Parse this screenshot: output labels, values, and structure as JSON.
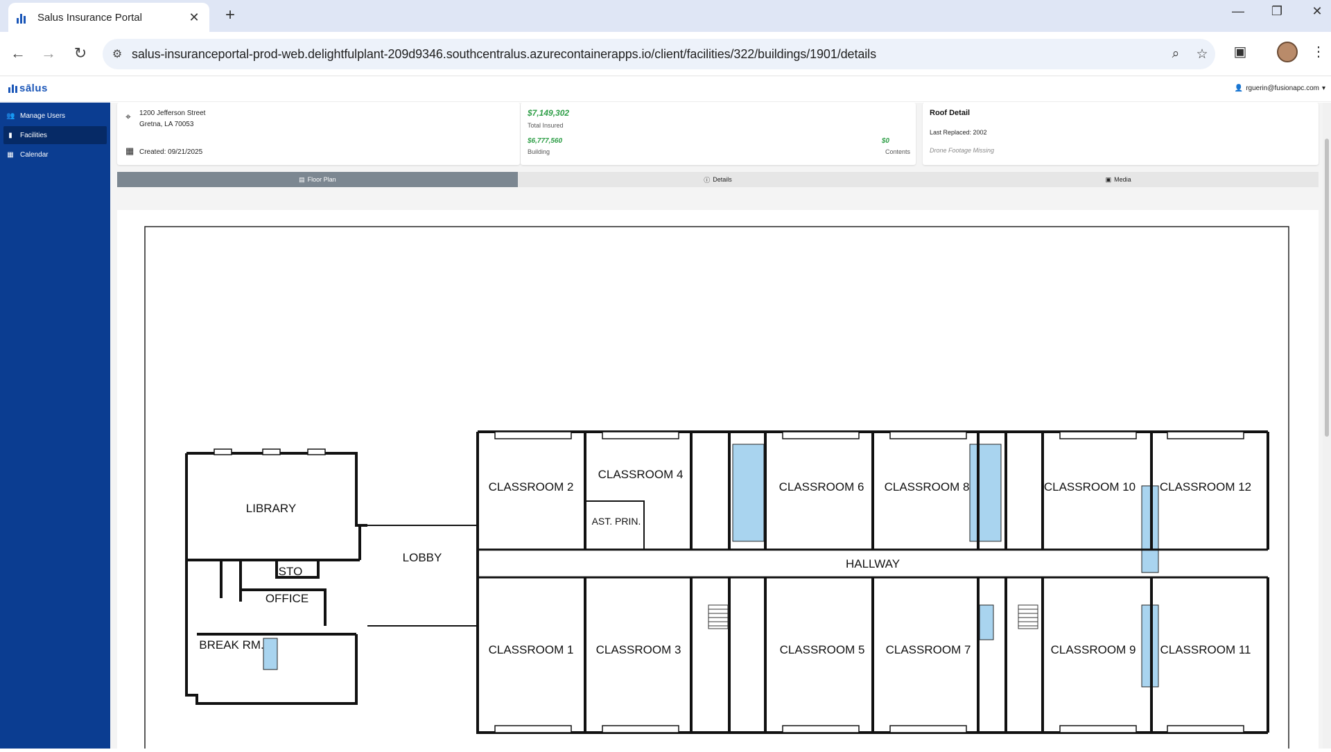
{
  "browser": {
    "tab_title": "Salus Insurance Portal",
    "url": "salus-insuranceportal-prod-web.delightfulplant-209d9346.southcentralus.azurecontainerapps.io/client/facilities/322/buildings/1901/details",
    "icons": [
      "back-icon",
      "forward-icon",
      "reload-icon",
      "tune-icon",
      "zoom-icon",
      "star-icon",
      "tab-search-icon",
      "profile-avatar",
      "menu-icon"
    ]
  },
  "app": {
    "logo_text": "sālus",
    "user_email": "rguerin@fusionapc.com",
    "sidebar": {
      "items": [
        {
          "label": "Manage Users",
          "icon": "users-icon",
          "active": false
        },
        {
          "label": "Facilities",
          "icon": "building-icon",
          "active": true
        },
        {
          "label": "Calendar",
          "icon": "calendar-icon",
          "active": false
        }
      ]
    },
    "address": {
      "line1": "1200 Jefferson Street",
      "line2": "Gretna, LA 70053",
      "created": "Created: 09/21/2025"
    },
    "insurance": {
      "total_value": "$7,149,302",
      "total_label": "Total Insured",
      "building_value": "$6,777,560",
      "building_label": "Building",
      "contents_value": "$0",
      "contents_label": "Contents"
    },
    "roof": {
      "title": "Roof Detail",
      "last_replaced": "Last Replaced: 2002",
      "drone": "Drone Footage Missing"
    },
    "tabs": [
      {
        "label": "Floor Plan",
        "icon": "floorplan-icon",
        "active": true
      },
      {
        "label": "Details",
        "icon": "info-icon",
        "active": false
      },
      {
        "label": "Media",
        "icon": "image-icon",
        "active": false
      }
    ],
    "floor_plan": {
      "rooms": {
        "library": "LIBRARY",
        "lobby": "LOBBY",
        "sto": "STO",
        "office": "OFFICE",
        "break_rm": "BREAK RM.",
        "hallway": "HALLWAY",
        "ast_prin": "AST. PRIN.",
        "c1": "CLASSROOM 1",
        "c2": "CLASSROOM 2",
        "c3": "CLASSROOM 3",
        "c4": "CLASSROOM 4",
        "c5": "CLASSROOM 5",
        "c6": "CLASSROOM 6",
        "c7": "CLASSROOM 7",
        "c8": "CLASSROOM 8",
        "c9": "CLASSROOM 9",
        "c10": "CLASSROOM 10",
        "c11": "CLASSROOM 11",
        "c12": "CLASSROOM 12"
      },
      "restroom_color": "#a9d4ef"
    }
  }
}
